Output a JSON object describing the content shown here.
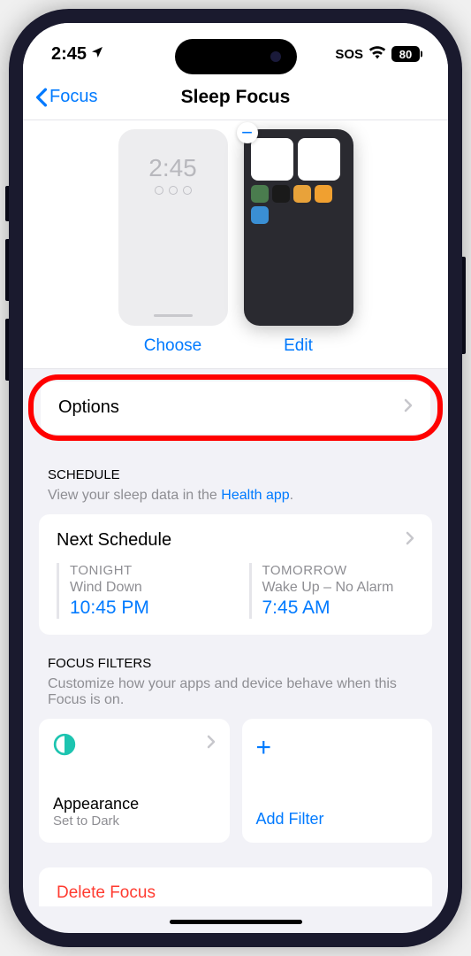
{
  "status": {
    "time": "2:45",
    "sos": "SOS",
    "battery": "80"
  },
  "nav": {
    "back": "Focus",
    "title": "Sleep Focus"
  },
  "screens": {
    "lock_time": "2:45",
    "choose": "Choose",
    "edit": "Edit"
  },
  "options": {
    "label": "Options"
  },
  "schedule": {
    "header": "SCHEDULE",
    "subtext": "View your sleep data in the ",
    "link": "Health app",
    "card_title": "Next Schedule",
    "tonight_label": "TONIGHT",
    "tonight_sub": "Wind Down",
    "tonight_time": "10:45 PM",
    "tomorrow_label": "TOMORROW",
    "tomorrow_sub": "Wake Up – No Alarm",
    "tomorrow_time": "7:45 AM"
  },
  "filters": {
    "header": "FOCUS FILTERS",
    "subtext": "Customize how your apps and device behave when this Focus is on.",
    "appearance_title": "Appearance",
    "appearance_sub": "Set to Dark",
    "add_filter": "Add Filter"
  },
  "delete": {
    "label": "Delete Focus"
  }
}
